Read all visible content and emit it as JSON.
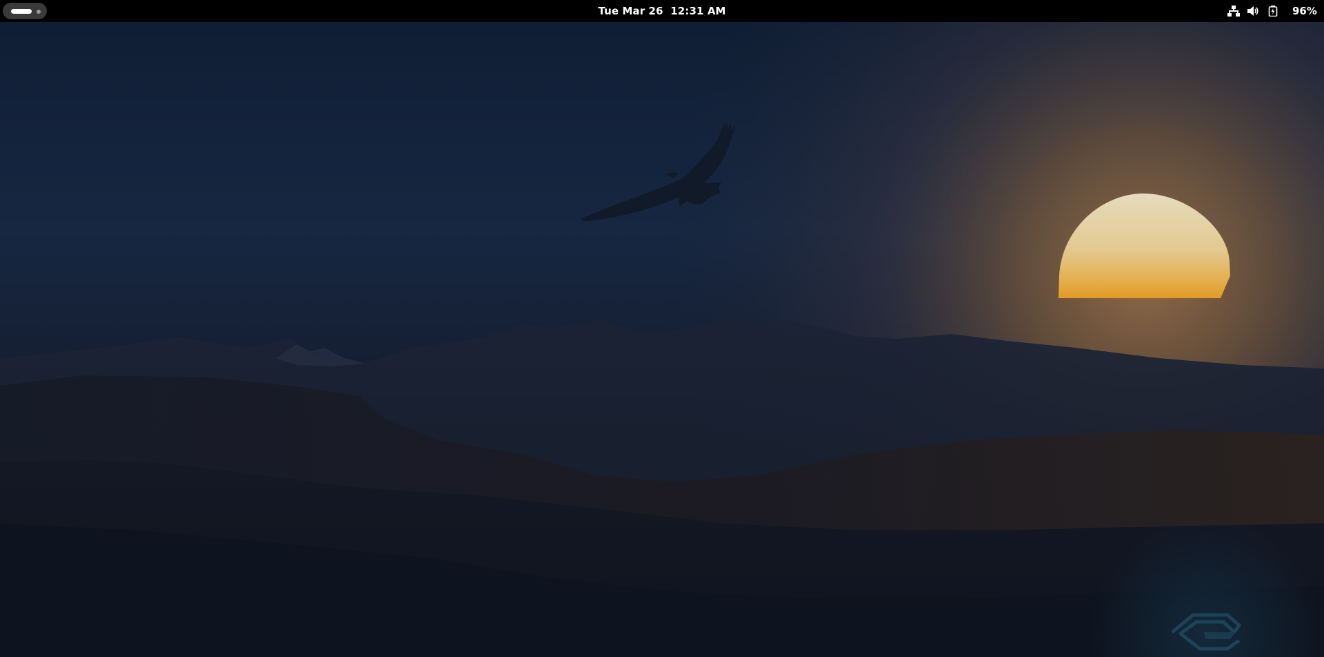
{
  "top_bar": {
    "activities": {
      "icon": "workspace-indicator-icon"
    },
    "clock": {
      "date": "Tue Mar 26",
      "time": "12:31 AM"
    },
    "status": {
      "network_icon": "network-wired-icon",
      "volume_icon": "volume-icon",
      "battery_icon": "battery-icon",
      "battery_percent": "96%"
    }
  },
  "desktop": {
    "wallpaper": {
      "subject": "eagle silhouette over mountains at sunset",
      "colors": {
        "sky_top": "#0f1d33",
        "sky_mid": "#1b2a44",
        "glow": "#7a5a3a",
        "sun_top": "#e7dcc0",
        "sun_bottom": "#e8a030",
        "ground": "#111723"
      }
    },
    "corner_logo_icon": "distro-logo-icon"
  }
}
